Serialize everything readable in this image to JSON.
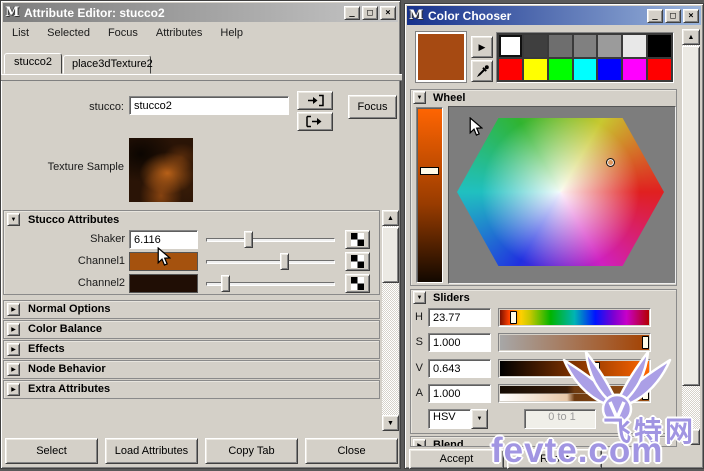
{
  "icons": {
    "maya": "M",
    "minimize": "_",
    "maximize": "□",
    "close": "×",
    "collapse_open": "▼",
    "collapse_closed": "▶",
    "scroll_up": "▲",
    "scroll_down": "▼",
    "dropdown": "▼",
    "palette_arrow": "▶"
  },
  "attribute_editor": {
    "title": "Attribute Editor: stucco2",
    "menu": {
      "list": "List",
      "selected": "Selected",
      "focus": "Focus",
      "attributes": "Attributes",
      "help": "Help"
    },
    "tabs": {
      "tab1": "stucco2",
      "tab2": "place3dTexture2"
    },
    "node": {
      "label": "stucco:",
      "value": "stucco2",
      "focus_button": "Focus"
    },
    "texture_sample_label": "Texture Sample",
    "stucco_section": {
      "title": "Stucco Attributes",
      "shaker": {
        "label": "Shaker",
        "value": "6.116"
      },
      "channel1": {
        "label": "Channel1",
        "color": "#A5520E"
      },
      "channel2": {
        "label": "Channel2",
        "color": "#200E05"
      }
    },
    "sections": {
      "s1": "Normal Options",
      "s2": "Color Balance",
      "s3": "Effects",
      "s4": "Node Behavior",
      "s5": "Extra Attributes"
    },
    "footer": {
      "select": "Select",
      "load": "Load Attributes",
      "copy": "Copy Tab",
      "close": "Close"
    }
  },
  "color_chooser": {
    "title": "Color Chooser",
    "current_color": "#A64A12",
    "palette": {
      "r1c1": "#FFFFFF",
      "r1c2": "#3F3F3F",
      "r1c3": "#6E6E6E",
      "r1c4": "#808080",
      "r1c5": "#9B9B9B",
      "r1c6": "#E8E8E8",
      "r1c7": "#000000",
      "r2c1": "#FF0000",
      "r2c2": "#FFFF00",
      "r2c3": "#00FF00",
      "r2c4": "#00FFFF",
      "r2c5": "#0000FF",
      "r2c6": "#FF00FF",
      "r2c7": "#FF0000"
    },
    "wheel_title": "Wheel",
    "sliders_title": "Sliders",
    "sliders": {
      "h": {
        "label": "H",
        "value": "23.77"
      },
      "s": {
        "label": "S",
        "value": "1.000"
      },
      "v": {
        "label": "V",
        "value": "0.643"
      },
      "a": {
        "label": "A",
        "value": "1.000"
      }
    },
    "mode": "HSV",
    "range": "0 to 1",
    "blend_title": "Blend",
    "footer": {
      "accept": "Accept",
      "reset": "Reset"
    }
  },
  "watermark": {
    "site_name": "飞特网",
    "site_url": "fevte.com"
  }
}
